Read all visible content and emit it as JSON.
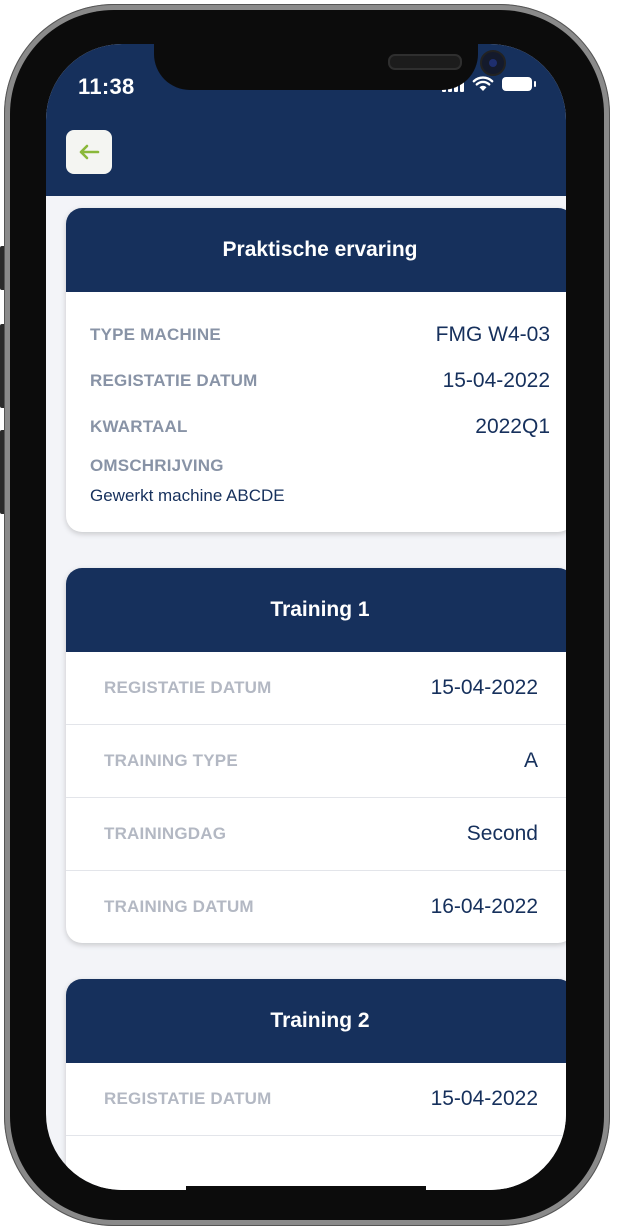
{
  "status_bar": {
    "time": "11:38"
  },
  "header": {
    "back_icon": "arrow-left-icon",
    "accent_color": "#8ab83a",
    "background": "#16305c"
  },
  "experience_card": {
    "title": "Praktische ervaring",
    "rows": [
      {
        "label": "TYPE MACHINE",
        "value": "FMG W4-03"
      },
      {
        "label": "REGISTATIE DATUM",
        "value": "15-04-2022"
      },
      {
        "label": "KWARTAAL",
        "value": "2022Q1"
      }
    ],
    "description_label": "OMSCHRIJVING",
    "description_value": "Gewerkt machine ABCDE"
  },
  "training_cards": [
    {
      "title": "Training 1",
      "rows": [
        {
          "label": "REGISTATIE DATUM",
          "value": "15-04-2022"
        },
        {
          "label": "TRAINING TYPE",
          "value": "A"
        },
        {
          "label": "TRAININGDAG",
          "value": "Second"
        },
        {
          "label": "TRAINING DATUM",
          "value": "16-04-2022"
        }
      ]
    },
    {
      "title": "Training 2",
      "rows": [
        {
          "label": "REGISTATIE DATUM",
          "value": "15-04-2022"
        }
      ]
    }
  ]
}
